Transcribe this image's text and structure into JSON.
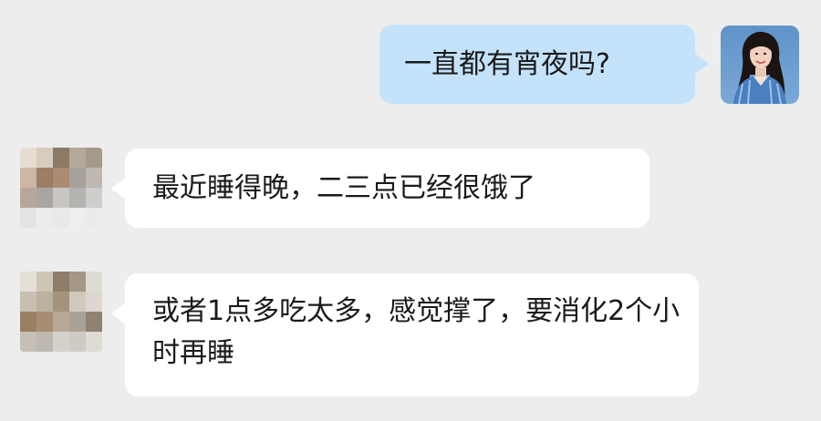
{
  "conversation": {
    "messages": [
      {
        "sender": "self",
        "text": "一直都有宵夜吗?"
      },
      {
        "sender": "other",
        "text": "最近睡得晚，二三点已经很饿了"
      },
      {
        "sender": "other",
        "text": "或者1点多吃太多，感觉撑了，要消化2个小时再睡"
      }
    ]
  },
  "colors": {
    "background": "#ededed",
    "outgoing_bubble": "#c4e3fb",
    "incoming_bubble": "#ffffff",
    "text": "#1a1a1a"
  },
  "avatar_mosaic_1": [
    "#e6ddd2",
    "#d8cdbd",
    "#8a7a66",
    "#b3a899",
    "#a59a8a",
    "#cdb6a3",
    "#9c7e66",
    "#ab8b71",
    "#a8a09a",
    "#bdb8b2",
    "#b7a79a",
    "#aaa5a2",
    "#c8c6c3",
    "#b5b3b2",
    "#cfcdcb",
    "#e5e3e1",
    "#ececeb",
    "#e9e9e8",
    "#eeeeed",
    "#ebebeb"
  ],
  "avatar_mosaic_2": [
    "#e4e0d8",
    "#cfc5b5",
    "#8d7e69",
    "#a39886",
    "#dedbd5",
    "#c8bfb1",
    "#bcb19f",
    "#a6937b",
    "#d0c9bd",
    "#dcd8d1",
    "#9b7f63",
    "#a88d73",
    "#b6a894",
    "#a8a298",
    "#8d8274",
    "#c6bfb6",
    "#bdb8b0",
    "#d5d1ca",
    "#cfcbc4",
    "#dedad4"
  ]
}
